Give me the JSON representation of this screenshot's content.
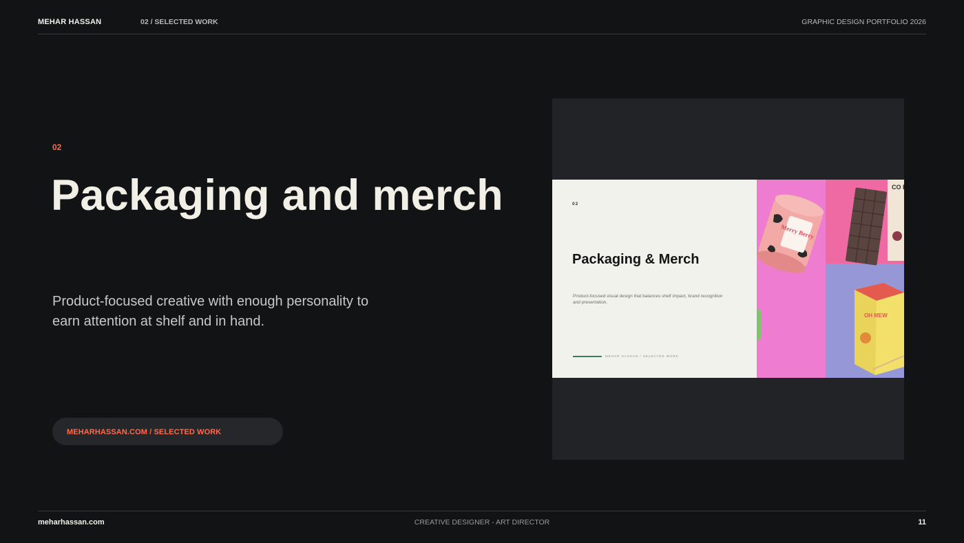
{
  "header": {
    "owner": "MEHAR HASSAN",
    "section": "02 / SELECTED WORK",
    "document": "GRAPHIC DESIGN PORTFOLIO 2026"
  },
  "main": {
    "number": "02",
    "title": "Packaging and merch",
    "description": "Product-focused creative with enough personality to earn attention at shelf and in hand.",
    "pill_label": "MEHARHASSAN.COM / SELECTED WORK"
  },
  "preview": {
    "number": "02",
    "title": "Packaging & Merch",
    "description": "Product-focused visual design that balances shelf impact, brand recognition and presentation.",
    "footer": "MEHAR HASSAN  /  SELECTED WORK",
    "jar_label": "Merry Berry",
    "box_label": "OH MEW",
    "card_label": "CO LI"
  },
  "footer": {
    "site": "meharhassan.com",
    "role": "CREATIVE DESIGNER - ART DIRECTOR",
    "page": "11"
  },
  "colors": {
    "background": "#121315",
    "accent": "#ff6a4d",
    "panel": "#222327",
    "slide": "#f2f2ed",
    "green_line": "#3c7a5a"
  }
}
